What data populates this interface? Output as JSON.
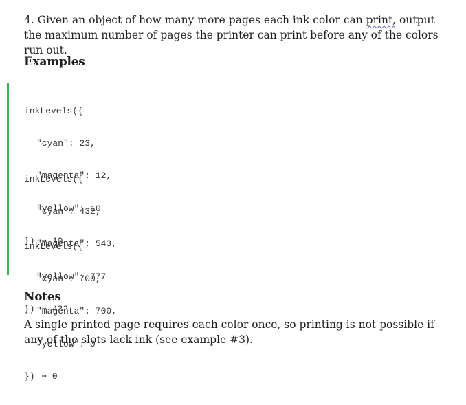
{
  "problem": {
    "number": "4.",
    "text_before": "Given an object of how many more pages each ink color can",
    "linked_word": "print,",
    "text_after": "output the maximum number of pages the printer can print before any of the colors run out."
  },
  "examples_heading": "Examples",
  "examples": [
    {
      "open": "inkLevels({",
      "lines": [
        "\"cyan\": 23,",
        "\"magenta\": 12,",
        "\"yellow\": 10"
      ],
      "close": "})",
      "arrow": "➞",
      "result": "10"
    },
    {
      "open": "inkLevels({",
      "lines": [
        "\"cyan\": 432,",
        "\"magenta\": 543,",
        "\"yellow\": 777"
      ],
      "close": "})",
      "arrow": "➞",
      "result": "432"
    },
    {
      "open": "inkLevels({",
      "lines": [
        "\"cyan\": 700,",
        "\"magenta\": 700,",
        "\"yellow\": 0"
      ],
      "close": "})",
      "arrow": "➞",
      "result": "0"
    }
  ],
  "notes_heading": "Notes",
  "notes_text": "A single printed page requires each color once, so printing is not possible if any of the slots lack ink (see example #3).",
  "colors": {
    "accent_bar": "#3bb44a",
    "text": "#1f1f1f",
    "code_text": "#333333"
  }
}
